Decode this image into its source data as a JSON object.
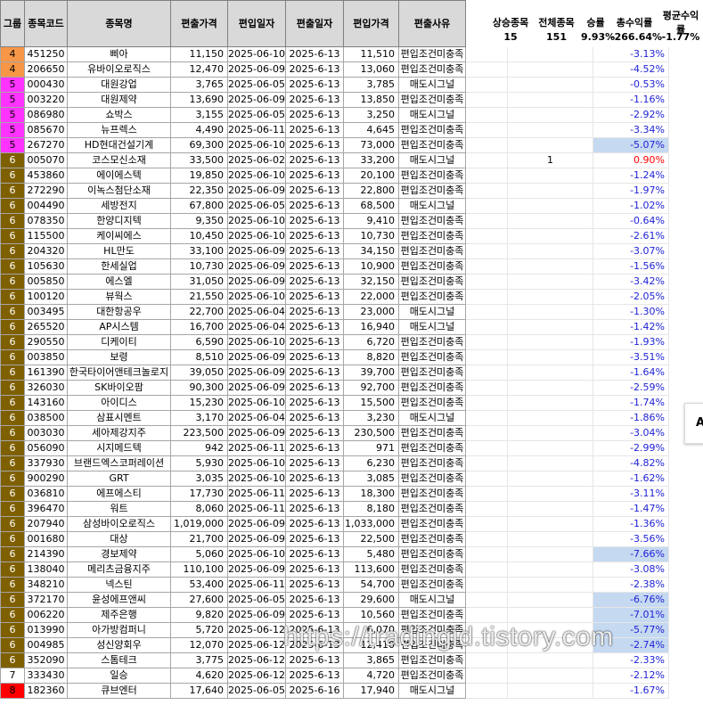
{
  "headers": {
    "group": "그룹",
    "code": "종목코드",
    "name": "종목명",
    "out_price": "편출가격",
    "in_date": "편입일자",
    "out_date": "편출일자",
    "in_price": "편입가격",
    "reason": "편출사유",
    "up_count": "상승종목",
    "total_count": "전체종목",
    "win_rate": "승률",
    "total_return": "총수익률",
    "avg_return": "평균수익률"
  },
  "stats": {
    "up_count": "15",
    "total_count": "151",
    "win_rate": "9.93%",
    "total_return": "-266.64%",
    "avg_return": "-1.77%"
  },
  "group_colors": {
    "4": "#f79646",
    "5": "#ff33ff",
    "6": "#7f6000",
    "7": "#ffffff",
    "8": "#ff0000"
  },
  "rows": [
    {
      "group": "4",
      "code": "451250",
      "name": "삐아",
      "out_price": "11,150",
      "in_date": "2025-06-10",
      "out_date": "2025-6-13",
      "in_price": "11,510",
      "reason": "편입조건미충족",
      "up": "",
      "ret": "-3.13%",
      "hl": false,
      "pos": false
    },
    {
      "group": "4",
      "code": "206650",
      "name": "유바이오로직스",
      "out_price": "12,470",
      "in_date": "2025-06-09",
      "out_date": "2025-6-13",
      "in_price": "13,060",
      "reason": "편입조건미충족",
      "up": "",
      "ret": "-4.52%",
      "hl": false,
      "pos": false
    },
    {
      "group": "5",
      "code": "000430",
      "name": "대원강업",
      "out_price": "3,765",
      "in_date": "2025-06-05",
      "out_date": "2025-6-13",
      "in_price": "3,785",
      "reason": "매도시그널",
      "up": "",
      "ret": "-0.53%",
      "hl": false,
      "pos": false
    },
    {
      "group": "5",
      "code": "003220",
      "name": "대원제약",
      "out_price": "13,690",
      "in_date": "2025-06-09",
      "out_date": "2025-6-13",
      "in_price": "13,850",
      "reason": "편입조건미충족",
      "up": "",
      "ret": "-1.16%",
      "hl": false,
      "pos": false
    },
    {
      "group": "5",
      "code": "086980",
      "name": "쇼박스",
      "out_price": "3,155",
      "in_date": "2025-06-05",
      "out_date": "2025-6-13",
      "in_price": "3,250",
      "reason": "매도시그널",
      "up": "",
      "ret": "-2.92%",
      "hl": false,
      "pos": false
    },
    {
      "group": "5",
      "code": "085670",
      "name": "뉴프렉스",
      "out_price": "4,490",
      "in_date": "2025-06-11",
      "out_date": "2025-6-13",
      "in_price": "4,645",
      "reason": "편입조건미충족",
      "up": "",
      "ret": "-3.34%",
      "hl": false,
      "pos": false
    },
    {
      "group": "5",
      "code": "267270",
      "name": "HD현대건설기계",
      "out_price": "69,300",
      "in_date": "2025-06-10",
      "out_date": "2025-6-13",
      "in_price": "73,000",
      "reason": "편입조건미충족",
      "up": "",
      "ret": "-5.07%",
      "hl": true,
      "pos": false
    },
    {
      "group": "6",
      "code": "005070",
      "name": "코스모신소재",
      "out_price": "33,500",
      "in_date": "2025-06-02",
      "out_date": "2025-6-13",
      "in_price": "33,200",
      "reason": "매도시그널",
      "up": "1",
      "ret": "0.90%",
      "hl": false,
      "pos": true
    },
    {
      "group": "6",
      "code": "453860",
      "name": "에이에스텍",
      "out_price": "19,850",
      "in_date": "2025-06-10",
      "out_date": "2025-6-13",
      "in_price": "20,100",
      "reason": "편입조건미충족",
      "up": "",
      "ret": "-1.24%",
      "hl": false,
      "pos": false
    },
    {
      "group": "6",
      "code": "272290",
      "name": "이녹스첨단소재",
      "out_price": "22,350",
      "in_date": "2025-06-09",
      "out_date": "2025-6-13",
      "in_price": "22,800",
      "reason": "편입조건미충족",
      "up": "",
      "ret": "-1.97%",
      "hl": false,
      "pos": false
    },
    {
      "group": "6",
      "code": "004490",
      "name": "세방전지",
      "out_price": "67,800",
      "in_date": "2025-06-05",
      "out_date": "2025-6-13",
      "in_price": "68,500",
      "reason": "매도시그널",
      "up": "",
      "ret": "-1.02%",
      "hl": false,
      "pos": false
    },
    {
      "group": "6",
      "code": "078350",
      "name": "한양디지텍",
      "out_price": "9,350",
      "in_date": "2025-06-10",
      "out_date": "2025-6-13",
      "in_price": "9,410",
      "reason": "편입조건미충족",
      "up": "",
      "ret": "-0.64%",
      "hl": false,
      "pos": false
    },
    {
      "group": "6",
      "code": "115500",
      "name": "케이씨에스",
      "out_price": "10,450",
      "in_date": "2025-06-10",
      "out_date": "2025-6-13",
      "in_price": "10,730",
      "reason": "편입조건미충족",
      "up": "",
      "ret": "-2.61%",
      "hl": false,
      "pos": false
    },
    {
      "group": "6",
      "code": "204320",
      "name": "HL만도",
      "out_price": "33,100",
      "in_date": "2025-06-09",
      "out_date": "2025-6-13",
      "in_price": "34,150",
      "reason": "편입조건미충족",
      "up": "",
      "ret": "-3.07%",
      "hl": false,
      "pos": false
    },
    {
      "group": "6",
      "code": "105630",
      "name": "한세실업",
      "out_price": "10,730",
      "in_date": "2025-06-09",
      "out_date": "2025-6-13",
      "in_price": "10,900",
      "reason": "편입조건미충족",
      "up": "",
      "ret": "-1.56%",
      "hl": false,
      "pos": false
    },
    {
      "group": "6",
      "code": "005850",
      "name": "에스엘",
      "out_price": "31,050",
      "in_date": "2025-06-09",
      "out_date": "2025-6-13",
      "in_price": "32,150",
      "reason": "편입조건미충족",
      "up": "",
      "ret": "-3.42%",
      "hl": false,
      "pos": false
    },
    {
      "group": "6",
      "code": "100120",
      "name": "뷰웍스",
      "out_price": "21,550",
      "in_date": "2025-06-10",
      "out_date": "2025-6-13",
      "in_price": "22,000",
      "reason": "편입조건미충족",
      "up": "",
      "ret": "-2.05%",
      "hl": false,
      "pos": false
    },
    {
      "group": "6",
      "code": "003495",
      "name": "대한항공우",
      "out_price": "22,700",
      "in_date": "2025-06-04",
      "out_date": "2025-6-13",
      "in_price": "23,000",
      "reason": "매도시그널",
      "up": "",
      "ret": "-1.30%",
      "hl": false,
      "pos": false
    },
    {
      "group": "6",
      "code": "265520",
      "name": "AP시스템",
      "out_price": "16,700",
      "in_date": "2025-06-04",
      "out_date": "2025-6-13",
      "in_price": "16,940",
      "reason": "매도시그널",
      "up": "",
      "ret": "-1.42%",
      "hl": false,
      "pos": false
    },
    {
      "group": "6",
      "code": "290550",
      "name": "디케이티",
      "out_price": "6,590",
      "in_date": "2025-06-10",
      "out_date": "2025-6-13",
      "in_price": "6,720",
      "reason": "편입조건미충족",
      "up": "",
      "ret": "-1.93%",
      "hl": false,
      "pos": false
    },
    {
      "group": "6",
      "code": "003850",
      "name": "보령",
      "out_price": "8,510",
      "in_date": "2025-06-09",
      "out_date": "2025-6-13",
      "in_price": "8,820",
      "reason": "편입조건미충족",
      "up": "",
      "ret": "-3.51%",
      "hl": false,
      "pos": false
    },
    {
      "group": "6",
      "code": "161390",
      "name": "한국타이어앤테크놀로지",
      "out_price": "39,050",
      "in_date": "2025-06-09",
      "out_date": "2025-6-13",
      "in_price": "39,700",
      "reason": "편입조건미충족",
      "up": "",
      "ret": "-1.64%",
      "hl": false,
      "pos": false
    },
    {
      "group": "6",
      "code": "326030",
      "name": "SK바이오팜",
      "out_price": "90,300",
      "in_date": "2025-06-09",
      "out_date": "2025-6-13",
      "in_price": "92,700",
      "reason": "편입조건미충족",
      "up": "",
      "ret": "-2.59%",
      "hl": false,
      "pos": false
    },
    {
      "group": "6",
      "code": "143160",
      "name": "아이디스",
      "out_price": "15,230",
      "in_date": "2025-06-10",
      "out_date": "2025-6-13",
      "in_price": "15,500",
      "reason": "편입조건미충족",
      "up": "",
      "ret": "-1.74%",
      "hl": false,
      "pos": false
    },
    {
      "group": "6",
      "code": "038500",
      "name": "삼표시멘트",
      "out_price": "3,170",
      "in_date": "2025-06-04",
      "out_date": "2025-6-13",
      "in_price": "3,230",
      "reason": "매도시그널",
      "up": "",
      "ret": "-1.86%",
      "hl": false,
      "pos": false
    },
    {
      "group": "6",
      "code": "003030",
      "name": "세아제강지주",
      "out_price": "223,500",
      "in_date": "2025-06-09",
      "out_date": "2025-6-13",
      "in_price": "230,500",
      "reason": "편입조건미충족",
      "up": "",
      "ret": "-3.04%",
      "hl": false,
      "pos": false
    },
    {
      "group": "6",
      "code": "056090",
      "name": "시지메드텍",
      "out_price": "942",
      "in_date": "2025-06-11",
      "out_date": "2025-6-13",
      "in_price": "971",
      "reason": "편입조건미충족",
      "up": "",
      "ret": "-2.99%",
      "hl": false,
      "pos": false
    },
    {
      "group": "6",
      "code": "337930",
      "name": "브랜드엑스코퍼레이션",
      "out_price": "5,930",
      "in_date": "2025-06-10",
      "out_date": "2025-6-13",
      "in_price": "6,230",
      "reason": "편입조건미충족",
      "up": "",
      "ret": "-4.82%",
      "hl": false,
      "pos": false
    },
    {
      "group": "6",
      "code": "900290",
      "name": "GRT",
      "out_price": "3,035",
      "in_date": "2025-06-10",
      "out_date": "2025-6-13",
      "in_price": "3,085",
      "reason": "편입조건미충족",
      "up": "",
      "ret": "-1.62%",
      "hl": false,
      "pos": false
    },
    {
      "group": "6",
      "code": "036810",
      "name": "에프에스티",
      "out_price": "17,730",
      "in_date": "2025-06-11",
      "out_date": "2025-6-13",
      "in_price": "18,300",
      "reason": "편입조건미충족",
      "up": "",
      "ret": "-3.11%",
      "hl": false,
      "pos": false
    },
    {
      "group": "6",
      "code": "396470",
      "name": "워트",
      "out_price": "8,060",
      "in_date": "2025-06-11",
      "out_date": "2025-6-13",
      "in_price": "8,180",
      "reason": "편입조건미충족",
      "up": "",
      "ret": "-1.47%",
      "hl": false,
      "pos": false
    },
    {
      "group": "6",
      "code": "207940",
      "name": "삼성바이오로직스",
      "out_price": "1,019,000",
      "in_date": "2025-06-09",
      "out_date": "2025-6-13",
      "in_price": "1,033,000",
      "reason": "편입조건미충족",
      "up": "",
      "ret": "-1.36%",
      "hl": false,
      "pos": false
    },
    {
      "group": "6",
      "code": "001680",
      "name": "대상",
      "out_price": "21,700",
      "in_date": "2025-06-09",
      "out_date": "2025-6-13",
      "in_price": "22,500",
      "reason": "편입조건미충족",
      "up": "",
      "ret": "-3.56%",
      "hl": false,
      "pos": false
    },
    {
      "group": "6",
      "code": "214390",
      "name": "경보제약",
      "out_price": "5,060",
      "in_date": "2025-06-10",
      "out_date": "2025-6-13",
      "in_price": "5,480",
      "reason": "편입조건미충족",
      "up": "",
      "ret": "-7.66%",
      "hl": true,
      "pos": false
    },
    {
      "group": "6",
      "code": "138040",
      "name": "메리츠금융지주",
      "out_price": "110,100",
      "in_date": "2025-06-09",
      "out_date": "2025-6-13",
      "in_price": "113,600",
      "reason": "편입조건미충족",
      "up": "",
      "ret": "-3.08%",
      "hl": false,
      "pos": false
    },
    {
      "group": "6",
      "code": "348210",
      "name": "넥스틴",
      "out_price": "53,400",
      "in_date": "2025-06-11",
      "out_date": "2025-6-13",
      "in_price": "54,700",
      "reason": "편입조건미충족",
      "up": "",
      "ret": "-2.38%",
      "hl": false,
      "pos": false
    },
    {
      "group": "6",
      "code": "372170",
      "name": "윤성에프앤씨",
      "out_price": "27,600",
      "in_date": "2025-06-05",
      "out_date": "2025-6-13",
      "in_price": "29,600",
      "reason": "매도시그널",
      "up": "",
      "ret": "-6.76%",
      "hl": true,
      "pos": false
    },
    {
      "group": "6",
      "code": "006220",
      "name": "제주은행",
      "out_price": "9,820",
      "in_date": "2025-06-09",
      "out_date": "2025-6-13",
      "in_price": "10,560",
      "reason": "편입조건미충족",
      "up": "",
      "ret": "-7.01%",
      "hl": true,
      "pos": false
    },
    {
      "group": "6",
      "code": "013990",
      "name": "아가방컴퍼니",
      "out_price": "5,720",
      "in_date": "2025-06-12",
      "out_date": "2025-6-13",
      "in_price": "6,070",
      "reason": "편입조건미충족",
      "up": "",
      "ret": "-5.77%",
      "hl": true,
      "pos": false
    },
    {
      "group": "6",
      "code": "004985",
      "name": "성신양회우",
      "out_price": "12,070",
      "in_date": "2025-06-12",
      "out_date": "2025-6-13",
      "in_price": "12,410",
      "reason": "편입조건미충족",
      "up": "",
      "ret": "-2.74%",
      "hl": true,
      "pos": false
    },
    {
      "group": "6",
      "code": "352090",
      "name": "스톰테크",
      "out_price": "3,775",
      "in_date": "2025-06-12",
      "out_date": "2025-6-13",
      "in_price": "3,865",
      "reason": "편입조건미충족",
      "up": "",
      "ret": "-2.33%",
      "hl": false,
      "pos": false
    },
    {
      "group": "7",
      "code": "333430",
      "name": "일승",
      "out_price": "4,620",
      "in_date": "2025-06-12",
      "out_date": "2025-6-13",
      "in_price": "4,720",
      "reason": "편입조건미충족",
      "up": "",
      "ret": "-2.12%",
      "hl": false,
      "pos": false
    },
    {
      "group": "8",
      "code": "182360",
      "name": "큐브엔터",
      "out_price": "17,640",
      "in_date": "2025-06-05",
      "out_date": "2025-6-16",
      "in_price": "17,940",
      "reason": "매도시그널",
      "up": "",
      "ret": "-1.67%",
      "hl": false,
      "pos": false
    }
  ],
  "edge_box_text": "A",
  "watermark": "https://tradingid.tistory.com"
}
